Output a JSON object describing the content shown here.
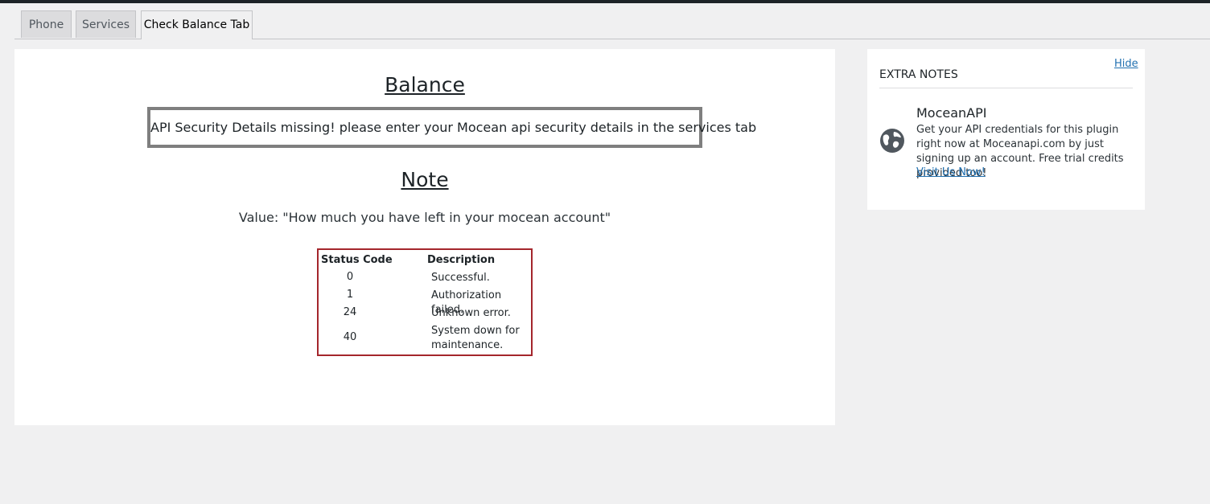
{
  "tabs": [
    {
      "label": "Phone",
      "active": false
    },
    {
      "label": "Services",
      "active": false
    },
    {
      "label": "Check Balance Tab",
      "active": true
    }
  ],
  "main": {
    "balance_heading": "Balance",
    "warning_message": "API Security Details missing! please enter your Mocean api security details in the services tab",
    "note_heading": "Note",
    "value_text": "Value: \"How much you have left in your mocean account\"",
    "table": {
      "headers": {
        "code": "Status Code",
        "description": "Description"
      },
      "rows": [
        {
          "code": "0",
          "description": "Successful."
        },
        {
          "code": "1",
          "description": "Authorization failed."
        },
        {
          "code": "24",
          "description": "Unknown error."
        },
        {
          "code": "40",
          "description": "System down for maintenance."
        }
      ]
    }
  },
  "sidebar": {
    "hide_label": "Hide",
    "title": "EXTRA NOTES",
    "icon": "globe-icon",
    "brand": "MoceanAPI",
    "description": "Get your API credentials for this plugin right now at Moceanapi.com by just signing up an account. Free trial credits provided too!",
    "visit_label": "Visit Us Now!"
  },
  "colors": {
    "page_background": "#f0f0f1",
    "panel_background": "#ffffff",
    "link": "#2271b1",
    "table_border": "#a4262c",
    "warning_border": "#7f7f7f"
  }
}
